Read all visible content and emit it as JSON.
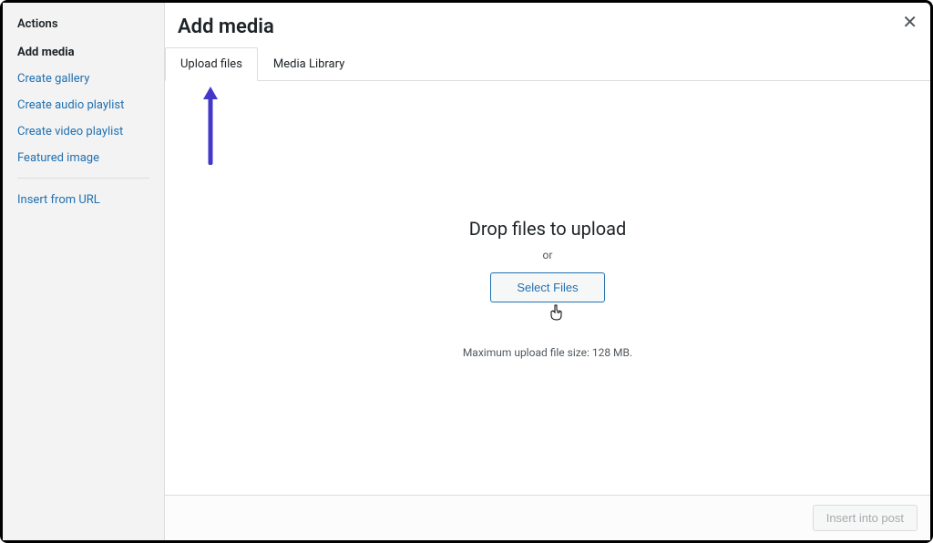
{
  "sidebar": {
    "title": "Actions",
    "active_item": "Add media",
    "links": [
      "Create gallery",
      "Create audio playlist",
      "Create video playlist",
      "Featured image"
    ],
    "insert_url": "Insert from URL"
  },
  "header": {
    "title": "Add media"
  },
  "tabs": {
    "upload": "Upload files",
    "library": "Media Library"
  },
  "upload_area": {
    "drop_text": "Drop files to upload",
    "or_text": "or",
    "select_button": "Select Files",
    "max_size_text": "Maximum upload file size: 128 MB."
  },
  "footer": {
    "insert_button": "Insert into post"
  }
}
